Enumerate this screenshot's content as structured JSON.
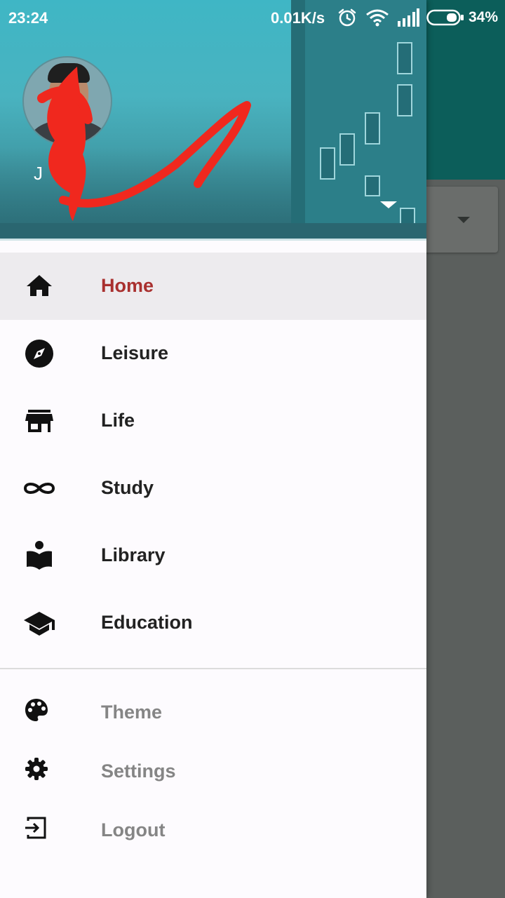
{
  "status_bar": {
    "time": "23:24",
    "net_speed": "0.01K/s",
    "battery": "34%",
    "icons": [
      "alarm-icon",
      "wifi-icon",
      "signal-icon",
      "battery-icon"
    ]
  },
  "header": {
    "username": "J",
    "accent": "#3fb6c5"
  },
  "menu": {
    "primary": [
      {
        "label": "Home",
        "icon": "home-icon",
        "active": true
      },
      {
        "label": "Leisure",
        "icon": "compass-icon"
      },
      {
        "label": "Life",
        "icon": "store-icon"
      },
      {
        "label": "Study",
        "icon": "infinity-icon"
      },
      {
        "label": "Library",
        "icon": "reader-icon"
      },
      {
        "label": "Education",
        "icon": "graduation-cap-icon"
      }
    ],
    "secondary": [
      {
        "label": "Theme",
        "icon": "palette-icon"
      },
      {
        "label": "Settings",
        "icon": "gear-icon"
      },
      {
        "label": "Logout",
        "icon": "exit-icon"
      }
    ],
    "active_color": "#a9302f"
  }
}
